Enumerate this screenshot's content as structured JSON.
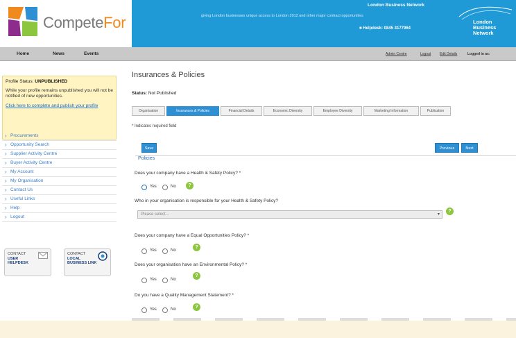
{
  "header": {
    "logo_prefix": "Compete",
    "logo_suffix": "For",
    "tagline": "giving London businesses unique access to London 2012 and other major contract opportunities",
    "network_top": "London Business Network",
    "helpdesk": "Helpdesk: 0845 3177964",
    "lbn_line1": "London",
    "lbn_line2": "Business",
    "lbn_line3": "Network"
  },
  "nav": {
    "items": [
      "Home",
      "News",
      "Events"
    ],
    "right_links": [
      "Admin Centre",
      "Logout",
      "Edit Details",
      "Logged in as:"
    ]
  },
  "sidebar": {
    "status_label": "Profile Status:",
    "status_value": "UNPUBLISHED",
    "status_message": "While your profile remains unpublished you will not be notified of new opportunities.",
    "status_link": "Click here to complete and publish your profile",
    "menu": [
      "Procurements",
      "Opportunity Search",
      "Supplier Activity Centre",
      "Buyer Activity Centre",
      "My Account",
      "My Organisation",
      "Contact Us",
      "Useful Links",
      "Help",
      "Logout"
    ],
    "contact_helpdesk": [
      "CONTACT",
      "USER",
      "HELPDESK"
    ],
    "contact_local": [
      "CONTACT",
      "LOCAL",
      "BUSINESS LINK"
    ]
  },
  "main": {
    "title": "Insurances & Policies",
    "status_label": "Status:",
    "status_value": "Not Published",
    "tabs": [
      "Organisation",
      "Insurances & Policies",
      "Financial Details",
      "Economic Diversity",
      "Employee Diversity",
      "Marketing Information",
      "Publication"
    ],
    "active_tab": 1,
    "required_note": "* Indicates required field",
    "save_label": "Save",
    "previous_label": "Previous",
    "next_label": "Next",
    "section_title": "Policies",
    "q1": "Does your company have a Health & Safety Policy? *",
    "q1_sub": "Who in your organisation is responsible for your Health & Safety Policy?",
    "select_placeholder": "Please select...",
    "q2": "Does your company have a Equal Opportunities Policy? *",
    "q3": "Does your organisation have an Environmental Policy? *",
    "q4": "Do you have a Quality Management Statement? *",
    "yes": "Yes",
    "no": "No",
    "help_symbol": "?"
  },
  "colors": {
    "header_blue": "#1f9ad6",
    "accent_blue": "#2f8fd3",
    "help_green": "#8cc63f",
    "status_yellow": "#fff4c2",
    "frame": "#fbf3dd"
  }
}
